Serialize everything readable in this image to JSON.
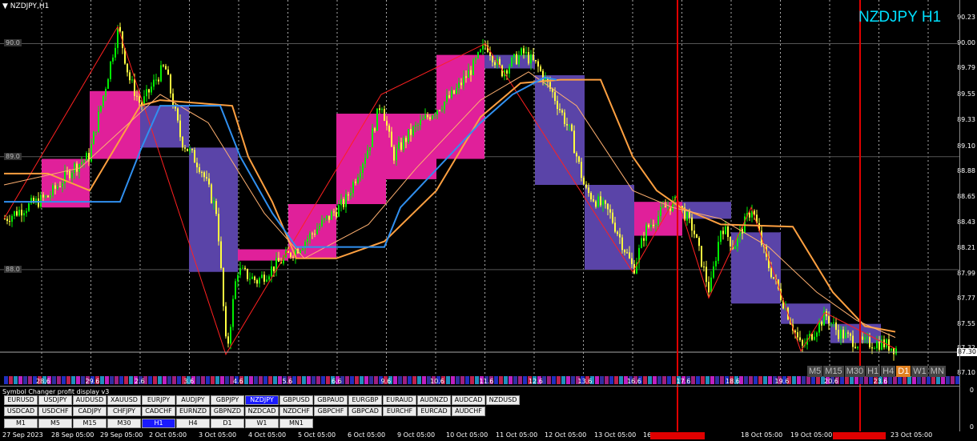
{
  "chart": {
    "title": "NZDJPY,H1",
    "symbol_big": "NZDJPY H1",
    "current_price": "87.30",
    "price_axis": [
      "90.23",
      "90.00",
      "89.79",
      "89.55",
      "89.33",
      "89.10",
      "88.88",
      "88.65",
      "88.43",
      "88.21",
      "87.99",
      "87.77",
      "87.55",
      "87.32",
      "87.10"
    ],
    "grid_labels": [
      "90.0",
      "89.0",
      "88.0"
    ],
    "day_labels": [
      "28.6",
      "29.6",
      "2.6",
      "3.6",
      "4.6",
      "5.6",
      "6.6",
      "9.6",
      "10.6",
      "11.6",
      "12.6",
      "13.6",
      "16.6",
      "17.6",
      "18.6",
      "19.6",
      "20.6",
      "23.6"
    ]
  },
  "timeframes": [
    {
      "label": "M5",
      "active": false
    },
    {
      "label": "M15",
      "active": false
    },
    {
      "label": "M30",
      "active": false
    },
    {
      "label": "H1",
      "active": false
    },
    {
      "label": "H4",
      "active": false
    },
    {
      "label": "D1",
      "active": true
    },
    {
      "label": "W1",
      "active": false
    },
    {
      "label": "MN",
      "active": false
    }
  ],
  "indicator": {
    "title": "Symbol Changer profit display v3",
    "axis_top": "0",
    "axis_bottom": "0",
    "row1": [
      "EURUSD",
      "USDJPY",
      "AUDUSD",
      "XAUUSD",
      "EURJPY",
      "AUDJPY",
      "GBPJPY",
      "NZDJPY",
      "GBPUSD",
      "GBPAUD",
      "EURGBP",
      "EURAUD",
      "AUDNZD",
      "AUDCAD",
      "NZDUSD"
    ],
    "row2": [
      "USDCAD",
      "USDCHF",
      "CADJPY",
      "CHFJPY",
      "CADCHF",
      "EURNZD",
      "GBPNZD",
      "NZDCAD",
      "NZDCHF",
      "GBPCHF",
      "GBPCAD",
      "EURCHF",
      "EURCAD",
      "AUDCHF"
    ],
    "row3": [
      "M1",
      "M5",
      "M15",
      "M30",
      "H1",
      "H4",
      "D1",
      "W1",
      "MN1"
    ],
    "active_symbol": "NZDJPY",
    "active_tf": "H1"
  },
  "time_axis": [
    "27 Sep 2023",
    "28 Sep 05:00",
    "29 Sep 05:00",
    "2 Oct 05:00",
    "3 Oct 05:00",
    "4 Oct 05:00",
    "5 Oct 05:00",
    "6 Oct 05:00",
    "9 Oct 05:00",
    "10 Oct 05:00",
    "11 Oct 05:00",
    "12 Oct 05:00",
    "13 Oct 05:00",
    "16",
    "18 Oct 05:00",
    "19 Oct 05:00",
    "20",
    "23 Oct 05:00"
  ],
  "colors": {
    "bull_box": "#e0209a",
    "bear_box": "#5a44a8",
    "candle_up": "#00ee00",
    "candle_down": "#ffff40",
    "slow_ma": "#ffa040",
    "fast_ma": "#3090f0",
    "zigzag": "#ff2020",
    "vline": "#e00000",
    "symbol_cyan": "#00e0ff"
  },
  "chart_data": {
    "type": "line",
    "title": "NZDJPY,H1",
    "ylim": [
      87.0,
      90.3
    ],
    "x": [
      "27 Sep",
      "28 Sep",
      "29 Sep",
      "2 Oct",
      "3 Oct",
      "4 Oct",
      "5 Oct",
      "6 Oct",
      "9 Oct",
      "10 Oct",
      "11 Oct",
      "12 Oct",
      "13 Oct",
      "16 Oct",
      "17 Oct",
      "18 Oct",
      "19 Oct",
      "20 Oct",
      "23 Oct"
    ],
    "series": [
      {
        "values": [
          88.6,
          88.9,
          90.0,
          89.2,
          88.4,
          87.9,
          88.1,
          88.6,
          89.3,
          89.5,
          90.0,
          89.7,
          88.7,
          88.1,
          88.6,
          88.4,
          88.3,
          87.5,
          87.4
        ]
      }
    ]
  }
}
